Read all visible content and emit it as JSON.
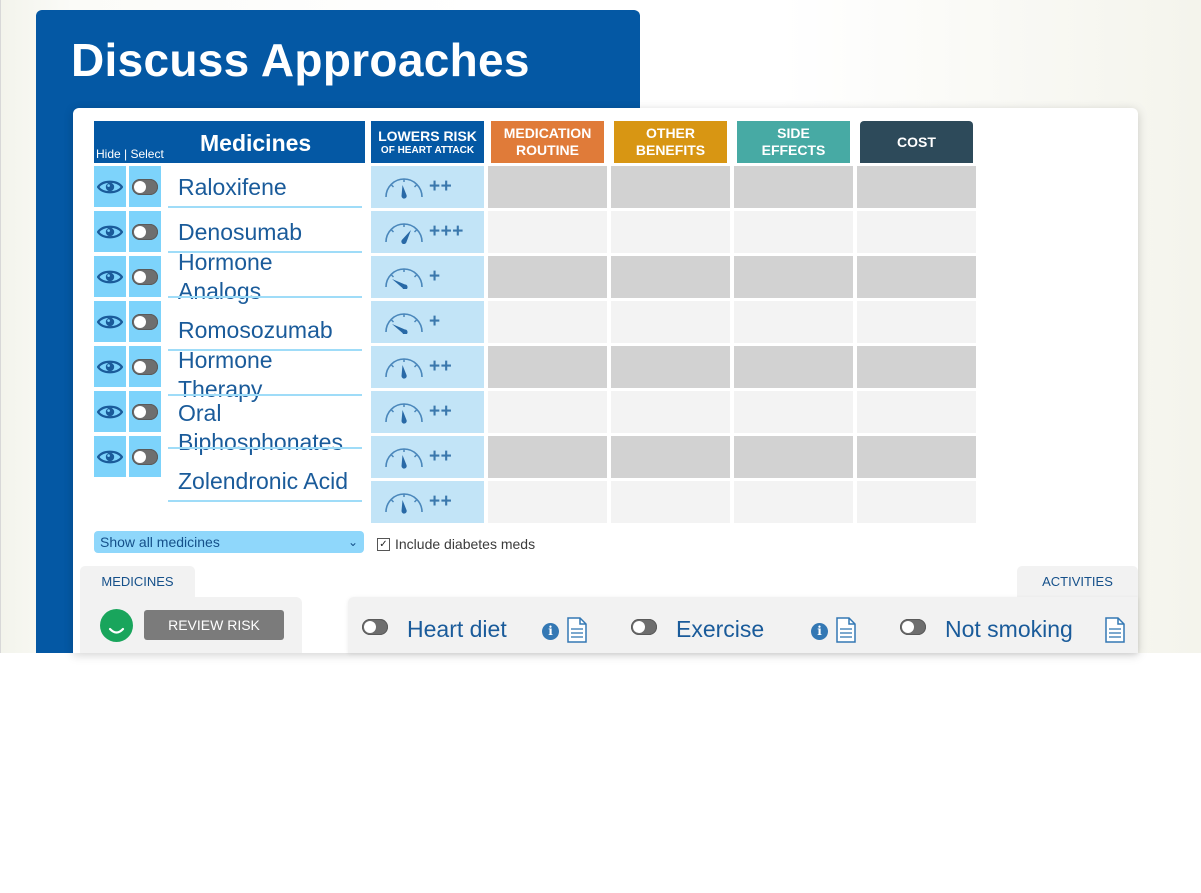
{
  "page_title": "Discuss Approaches",
  "medicines_header": {
    "hide_select": "Hide | Select",
    "title": "Medicines"
  },
  "columns": [
    {
      "label": "LOWERS RISK",
      "sub": "OF HEART ATTACK",
      "color": "#0458a4"
    },
    {
      "label": "MEDICATION ROUTINE",
      "color": "#e07b39"
    },
    {
      "label": "OTHER BENEFITS",
      "color": "#d89613"
    },
    {
      "label": "SIDE EFFECTS",
      "color": "#47aaa4"
    },
    {
      "label": "COST",
      "color": "#2d4a5a"
    }
  ],
  "medicines": [
    {
      "name": "Raloxifene"
    },
    {
      "name": "Denosumab"
    },
    {
      "name_line1": "Hormone",
      "name_line2": "Analogs"
    },
    {
      "name": "Romosozumab"
    },
    {
      "name_line1": "Hormone",
      "name_line2": "Therapy"
    },
    {
      "name_line1": "Oral",
      "name_line2": "Biphosphonates"
    },
    {
      "name": "Zolendronic Acid"
    }
  ],
  "risk_ratings": [
    "++",
    "+++",
    "+",
    "+",
    "++",
    "++",
    "++",
    "++"
  ],
  "show_select": {
    "value": "Show all medicines"
  },
  "include_checkbox": {
    "label": "Include diabetes meds",
    "checked": true
  },
  "tabs": {
    "medicines": "MEDICINES",
    "activities": "ACTIVITIES"
  },
  "review_button": "REVIEW RISK",
  "activities": [
    {
      "label": "Heart diet",
      "has_info": true
    },
    {
      "label": "Exercise",
      "has_info": true
    },
    {
      "label": "Not smoking",
      "has_info": false
    }
  ],
  "icons": {
    "eye": "eye-icon",
    "toggle": "toggle-switch",
    "gauge": "gauge-icon",
    "info": "info-icon",
    "document": "document-icon",
    "smiley": "smiley-icon"
  },
  "colors": {
    "brand_blue": "#0458a4",
    "eye_cell": "#7dd3fb",
    "risk_cell": "#c2e4f7",
    "grid_dark": "#d2d2d2",
    "grid_light": "#f3f3f3",
    "smiley_green": "#19a55c"
  }
}
